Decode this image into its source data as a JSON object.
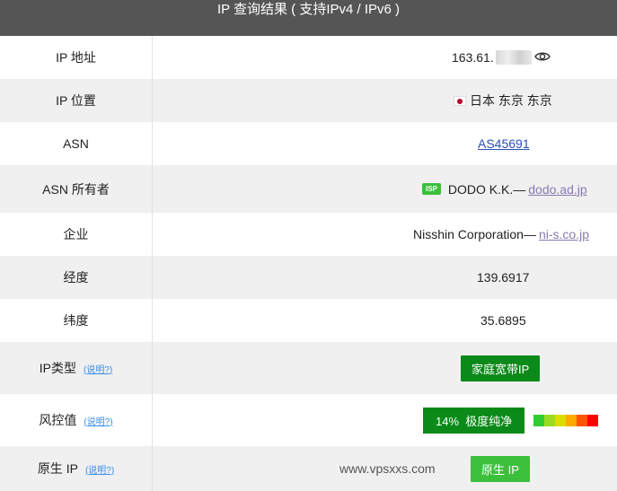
{
  "header": {
    "title": "IP 查询结果 ( 支持IPv4 / IPv6 )"
  },
  "help_text": "(说明?)",
  "rows": {
    "ip": {
      "label": "IP 地址",
      "value": "163.61."
    },
    "location": {
      "label": "IP 位置",
      "value": "日本 东京 东京"
    },
    "asn": {
      "label": "ASN",
      "value": "AS45691"
    },
    "asn_owner": {
      "label": "ASN 所有者",
      "badge": "ISP",
      "name": "DODO K.K.—",
      "domain": "dodo.ad.jp"
    },
    "company": {
      "label": "企业",
      "name": "Nisshin Corporation—",
      "domain": "ni-s.co.jp"
    },
    "longitude": {
      "label": "经度",
      "value": "139.6917"
    },
    "latitude": {
      "label": "纬度",
      "value": "35.6895"
    },
    "ip_type": {
      "label": "IP类型",
      "value": "家庭宽带IP"
    },
    "risk": {
      "label": "风控值",
      "value": "14%  极度纯净",
      "scale_colors": [
        "#33cc33",
        "#99dd22",
        "#dddd00",
        "#ffaa00",
        "#ff5500",
        "#ff0000"
      ]
    },
    "native": {
      "label": "原生 IP",
      "value": "原生 IP",
      "watermark": "www.vpsxxs.com"
    }
  },
  "icons": {
    "eye": "eye-icon",
    "flag": "japan-flag-icon"
  }
}
